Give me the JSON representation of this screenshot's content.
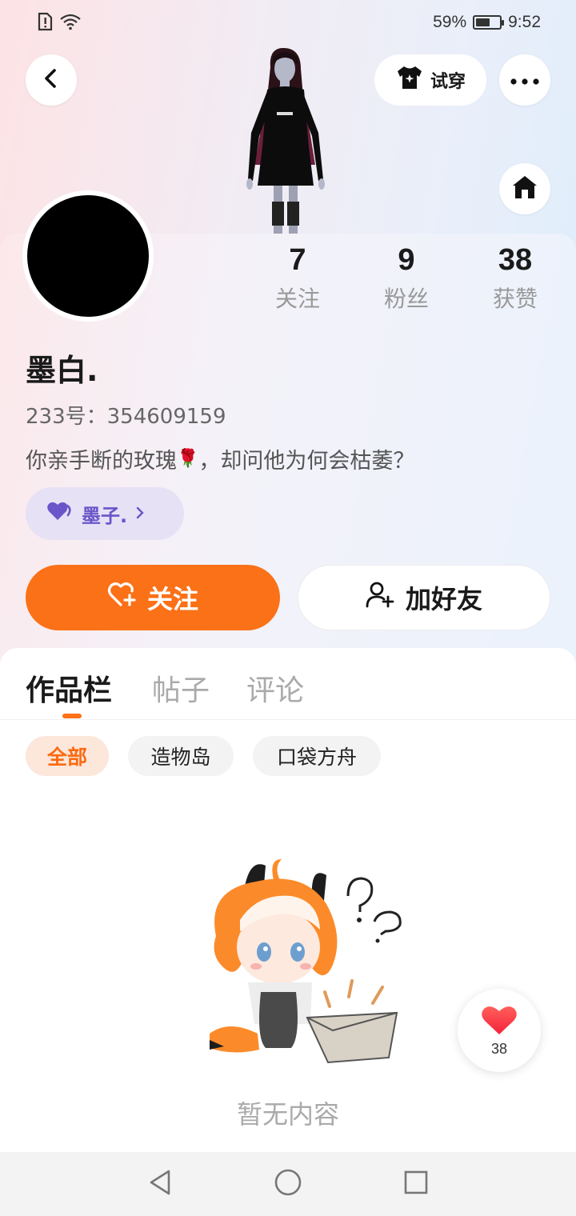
{
  "status": {
    "battery_text": "59%",
    "battery_level": 0.59,
    "time": "9:52"
  },
  "header": {
    "try_on_label": "试穿"
  },
  "stats": [
    {
      "value": "7",
      "label": "关注"
    },
    {
      "value": "9",
      "label": "粉丝"
    },
    {
      "value": "38",
      "label": "获赞"
    }
  ],
  "profile": {
    "nickname": "墨白.",
    "uid": "233号：354609159",
    "bio_before": "你亲手断的玫瑰",
    "bio_emoji": "🌹",
    "bio_after": "，却问他为何会枯萎？",
    "partner_name": "墨子."
  },
  "actions": {
    "follow_label": "关注",
    "add_friend_label": "加好友"
  },
  "tabs": [
    {
      "label": "作品栏",
      "active": true
    },
    {
      "label": "帖子",
      "active": false
    },
    {
      "label": "评论",
      "active": false
    }
  ],
  "filters": [
    {
      "label": "全部",
      "active": true
    },
    {
      "label": "造物岛",
      "active": false
    },
    {
      "label": "口袋方舟",
      "active": false
    }
  ],
  "empty_state": {
    "text": "暂无内容"
  },
  "floating_like": {
    "count": "38"
  },
  "colors": {
    "accent": "#fb7117",
    "partner_bg": "#e6e1f5",
    "partner_text": "#6a55c9"
  },
  "icons": [
    "sim-alert-icon",
    "wifi-icon",
    "battery-icon",
    "back-icon",
    "shirt-icon",
    "more-icon",
    "home-icon",
    "heart-outline-plus-icon",
    "add-user-icon",
    "chevron-right-icon",
    "heart-icon",
    "nav-back-icon",
    "nav-home-icon",
    "nav-recents-icon"
  ]
}
